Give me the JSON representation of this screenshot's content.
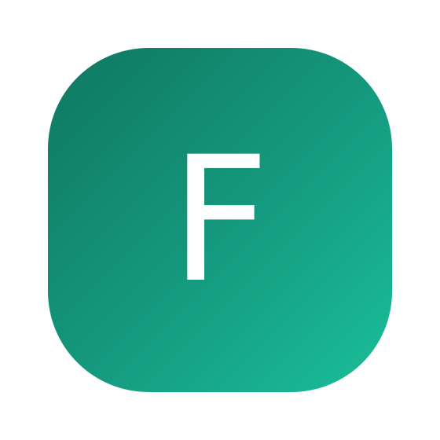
{
  "app_icon": {
    "letter": "F",
    "letter_color": "#ffffff",
    "gradient_start": "#0f7760",
    "gradient_end": "#1abf9a"
  }
}
